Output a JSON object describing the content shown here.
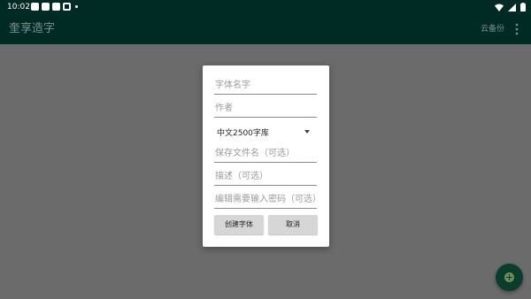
{
  "status_bar": {
    "time": "10:02"
  },
  "app_bar": {
    "title": "奎享造字",
    "backup_label": "云备份"
  },
  "dialog": {
    "font_name_placeholder": "字体名字",
    "author_placeholder": "作者",
    "charset_selected": "中文2500字库",
    "save_filename_placeholder": "保存文件名（可选）",
    "description_placeholder": "描述（可选）",
    "edit_password_placeholder": "编辑需要输入密码（可选）",
    "create_button_label": "创建字体",
    "cancel_button_label": "取消"
  },
  "colors": {
    "app_bar_bg": "#002b24",
    "scrim": "#6b6b6b",
    "fab_bg": "#0b3d2f",
    "fab_icon": "#6f8e54"
  }
}
